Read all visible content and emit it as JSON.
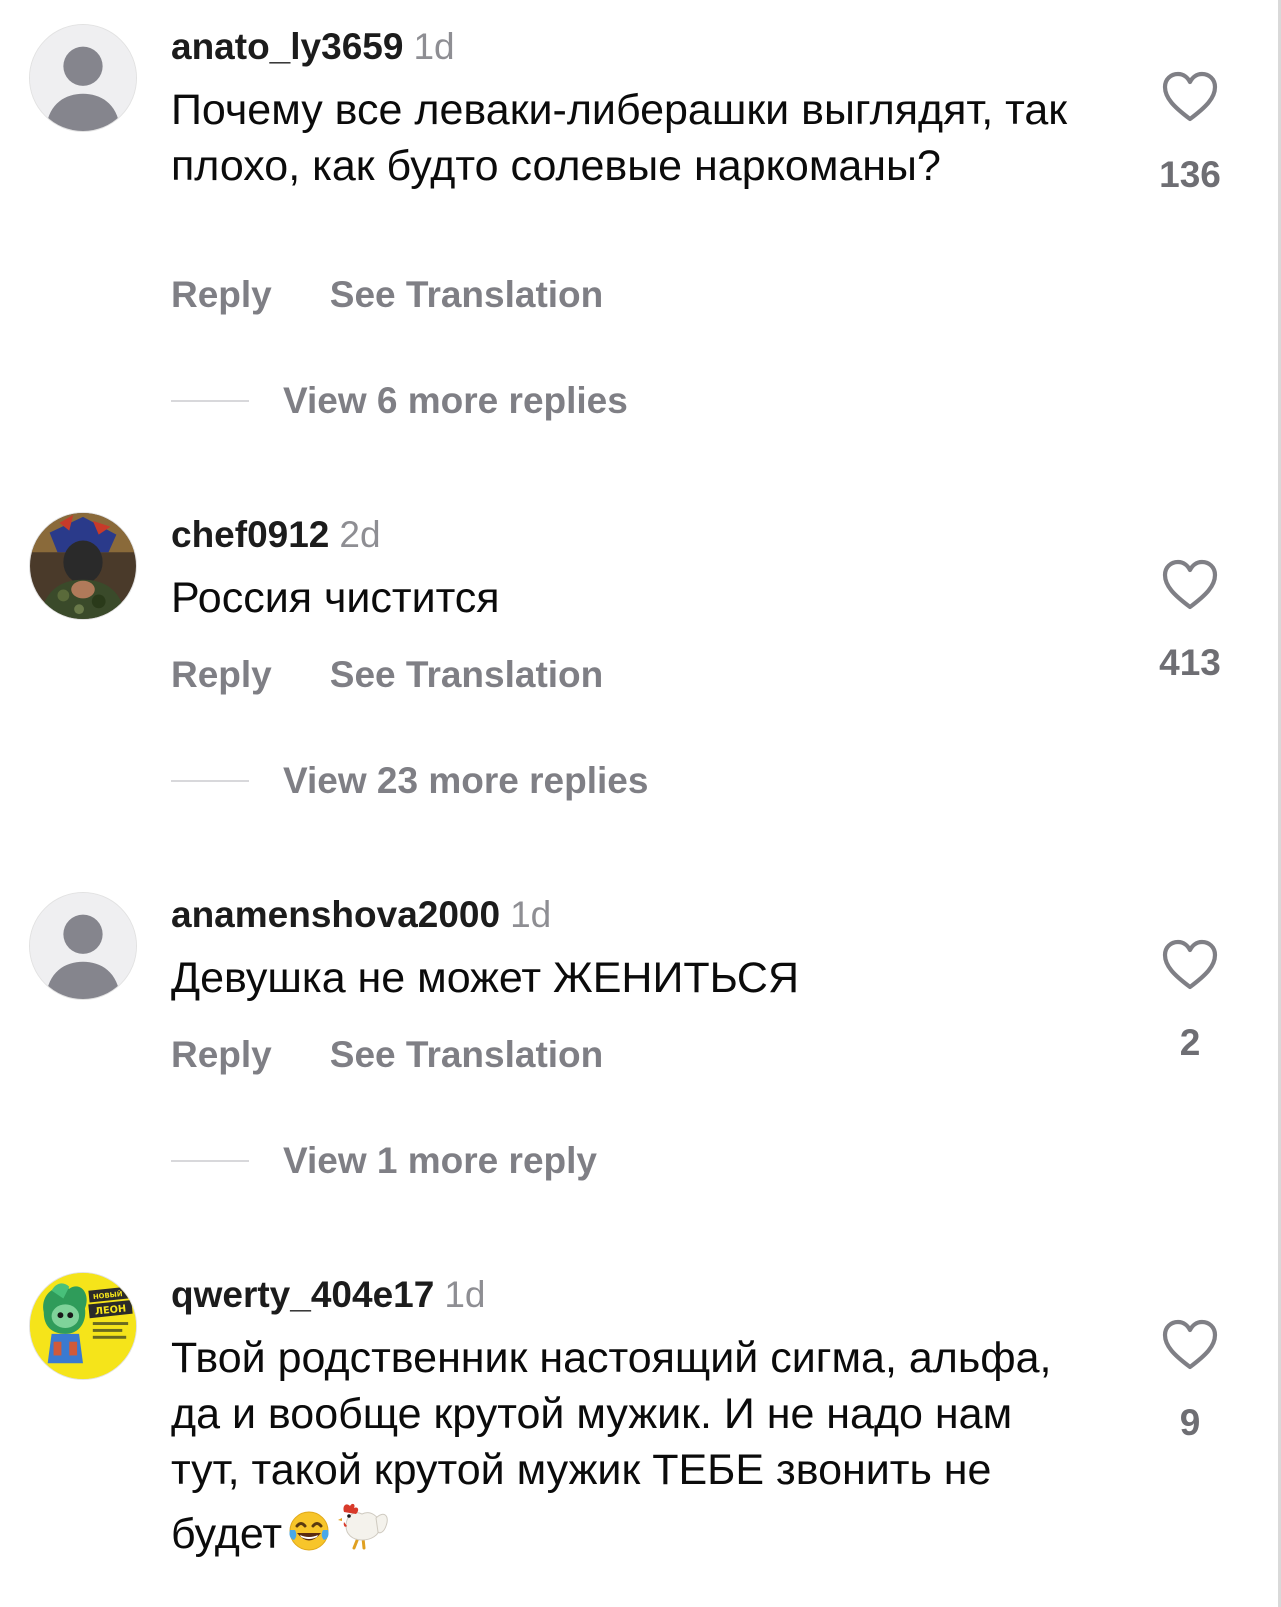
{
  "comments": [
    {
      "username": "anato_ly3659",
      "time": "1d",
      "text": "Почему все леваки-либерашки выглядят, так плохо, как будто солевые наркоманы?",
      "reply_label": "Reply",
      "translate_label": "See Translation",
      "view_replies": "View 6 more replies",
      "likes": "136",
      "avatar": "default-avatar"
    },
    {
      "username": "chef0912",
      "time": "2d",
      "text": "Россия чистится",
      "reply_label": "Reply",
      "translate_label": "See Translation",
      "view_replies": "View 23 more replies",
      "likes": "413",
      "avatar": "photo-avatar"
    },
    {
      "username": "anamenshova2000",
      "time": "1d",
      "text": "Девушка не может ЖЕНИТЬСЯ",
      "reply_label": "Reply",
      "translate_label": "See Translation",
      "view_replies": "View 1 more reply",
      "likes": "2",
      "avatar": "default-avatar"
    },
    {
      "username": "qwerty_404e17",
      "time": "1d",
      "text": "Твой родственник настоящий сигма, альфа, да и вообще крутой мужик. И не надо нам тут, такой крутой мужик ТЕБЕ звонить не будет",
      "text_emojis": [
        "tears-of-joy-emoji",
        "rooster-emoji"
      ],
      "likes": "9",
      "avatar": "yellow-game-avatar",
      "avatar_text": [
        "НОВЫЙ",
        "ЛЕОН"
      ]
    }
  ],
  "colors": {
    "username": "#1c1c1c",
    "secondary": "#7f7f85",
    "timestamp": "#8e8e93",
    "like_count": "#6e6e73",
    "avatar_yellow": "#f5e41a"
  }
}
